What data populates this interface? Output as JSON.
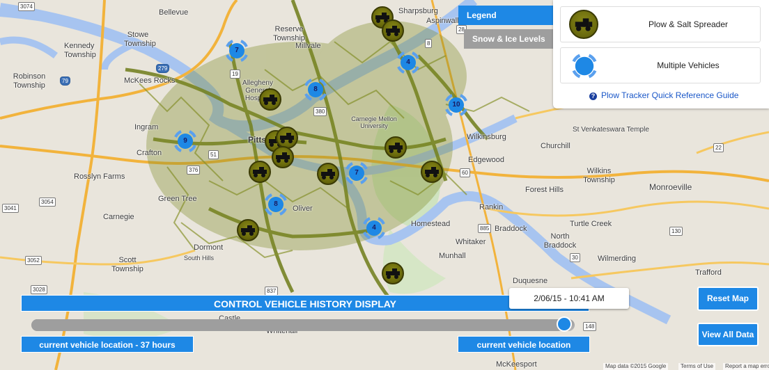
{
  "legend_tabs": {
    "legend": "Legend",
    "snow": "Snow & Ice Levels"
  },
  "legend": {
    "items": [
      {
        "label": "Plow & Salt Spreader",
        "icon": "plow-truck-icon"
      },
      {
        "label": "Multiple Vehicles",
        "icon": "cluster-icon"
      }
    ],
    "guide_link": "Plow Tracker Quick Reference Guide"
  },
  "controls": {
    "title": "CONTROL VEHICLE HISTORY DISPLAY",
    "timestamp": "2/06/15 - 10:41 AM",
    "left_label": "current vehicle location - 37 hours",
    "right_label": "current vehicle location",
    "slider_fraction": 0.98
  },
  "buttons": {
    "reset": "Reset Map",
    "view_all": "View All Data"
  },
  "footer": {
    "map_data": "Map data ©2015 Google",
    "terms": "Terms of Use",
    "report": "Report a map error"
  },
  "clusters": [
    "7",
    "8",
    "4",
    "10",
    "9",
    "7",
    "8",
    "4"
  ],
  "places": [
    "Bellevue",
    "Reserve Township",
    "Millvale",
    "Stowe Township",
    "Kennedy Township",
    "Robinson Township",
    "McKees Rocks",
    "Allegheny General Hospital",
    "Ingram",
    "Crafton",
    "Rosslyn Farms",
    "Carnegie",
    "Green Tree",
    "Oliver",
    "Dormont",
    "South Hills",
    "Scott Township",
    "Castle",
    "Whitehall",
    "Homestead",
    "Whitaker",
    "Munhall",
    "Rankin",
    "Braddock",
    "North Braddock",
    "Turtle Creek",
    "Wilmerding",
    "Forest Hills",
    "Wilkins Township",
    "Monroeville",
    "Edgewood",
    "Wilkinsburg",
    "Churchill",
    "St Venkateswara Temple",
    "Duquesne",
    "Trafford",
    "McKeesport",
    "Carnegie Mellon University",
    "Pittsburgh",
    "Sharpsburg",
    "Aspinwall"
  ],
  "shields": [
    "3074",
    "279",
    "79",
    "51",
    "19",
    "3041",
    "3054",
    "376",
    "380",
    "8",
    "3052",
    "3028",
    "885",
    "28",
    "130",
    "22",
    "148",
    "60",
    "30",
    "837"
  ],
  "colors": {
    "accent": "#1e88e5",
    "plow": "#6b6b0c",
    "river": "#a7c4f0",
    "route": "#6f7d1a"
  }
}
